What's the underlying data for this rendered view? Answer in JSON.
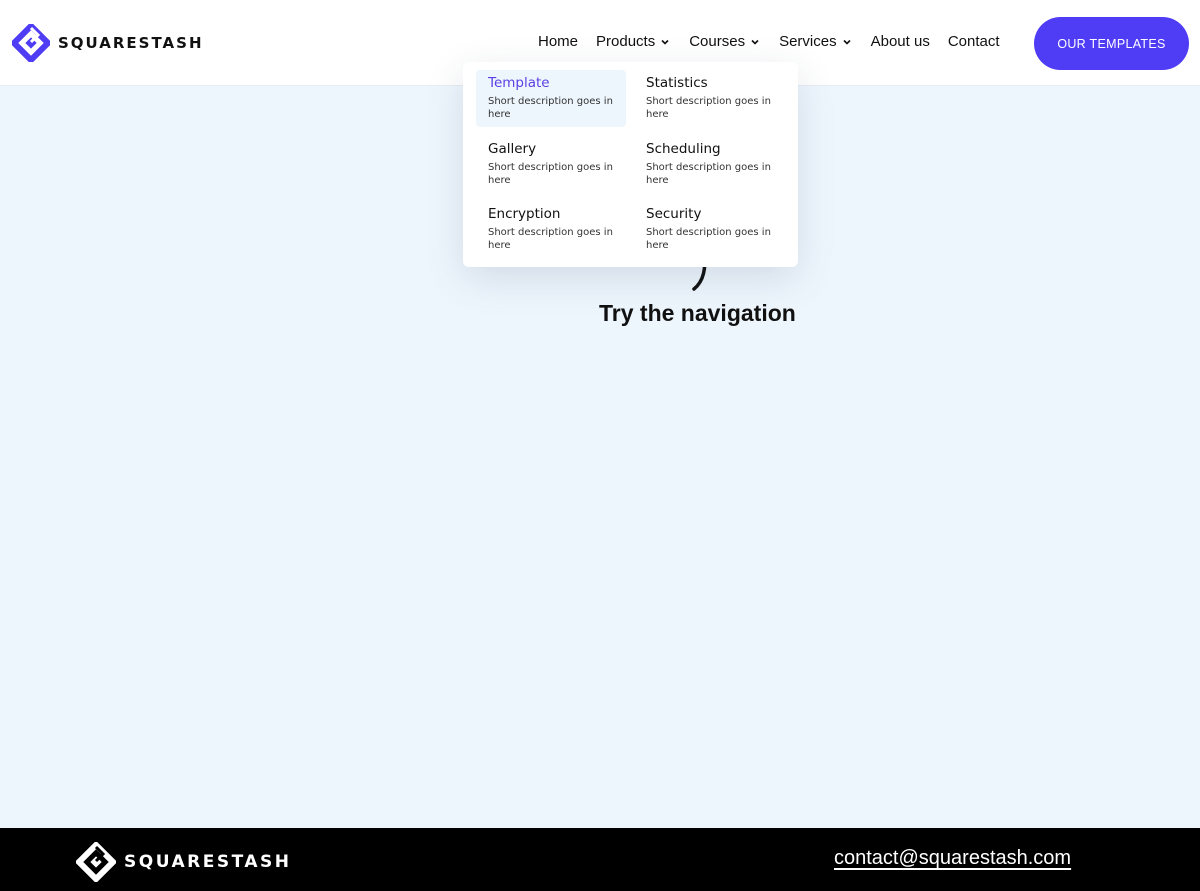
{
  "brand": {
    "name": "SQUARESTASH",
    "accent": "#4f3cf5"
  },
  "nav": {
    "items": [
      {
        "label": "Home",
        "has_dropdown": false
      },
      {
        "label": "Products",
        "has_dropdown": true
      },
      {
        "label": "Courses",
        "has_dropdown": true
      },
      {
        "label": "Services",
        "has_dropdown": true
      },
      {
        "label": "About us",
        "has_dropdown": false
      },
      {
        "label": "Contact",
        "has_dropdown": false
      }
    ],
    "cta_label": "OUR TEMPLATES"
  },
  "dropdown": {
    "items": [
      {
        "title": "Template",
        "desc": "Short description goes in here",
        "active": true
      },
      {
        "title": "Statistics",
        "desc": "Short description goes in here",
        "active": false
      },
      {
        "title": "Gallery",
        "desc": "Short description goes in here",
        "active": false
      },
      {
        "title": "Scheduling",
        "desc": "Short description goes in here",
        "active": false
      },
      {
        "title": "Encryption",
        "desc": "Short description goes in here",
        "active": false
      },
      {
        "title": "Security",
        "desc": "Short description goes in here",
        "active": false
      }
    ]
  },
  "hero": {
    "text": "Try the navigation"
  },
  "footer": {
    "brand": "SQUARESTASH",
    "email": "contact@squarestash.com"
  },
  "colors": {
    "background": "#eef6fd",
    "active_item_text": "#5b3ee6",
    "footer_bg": "#000000"
  }
}
